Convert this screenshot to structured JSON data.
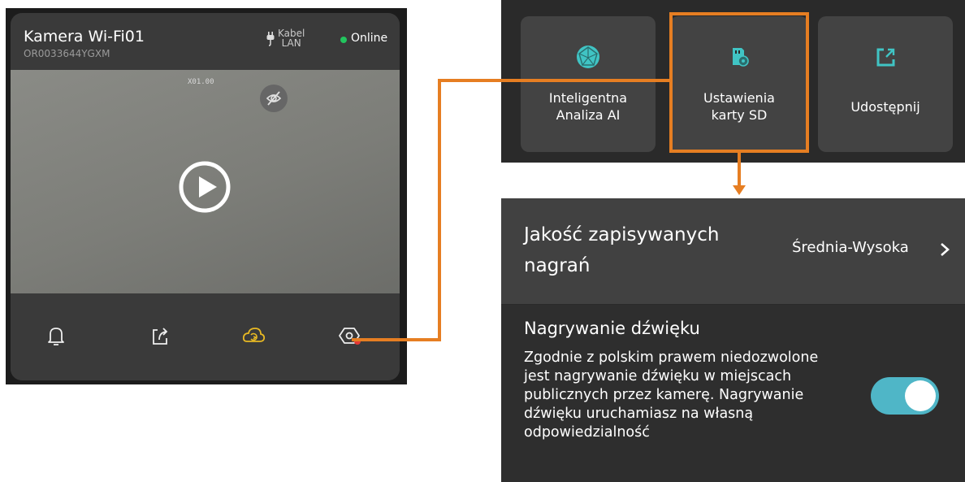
{
  "camera": {
    "title": "Kamera Wi-Fi01",
    "serial": "OR0033644YGXM",
    "connection_line1": "Kabel",
    "connection_line2": "LAN",
    "status": "Online",
    "zoom": "X01.00",
    "toolbar": {
      "alarm_icon": "bell-icon",
      "share_icon": "share-icon",
      "cloud_icon": "cloud-replay-icon",
      "settings_icon": "settings-icon"
    }
  },
  "tiles": [
    {
      "label_line1": "Inteligentna",
      "label_line2": "Analiza AI",
      "icon": "ai-analysis-icon"
    },
    {
      "label_line1": "Ustawienia",
      "label_line2": "karty SD",
      "icon": "sd-card-settings-icon"
    },
    {
      "label_line1": "Udostępnij",
      "label_line2": "",
      "icon": "share-icon"
    }
  ],
  "settings": {
    "quality_label": "Jakość zapisywanych nagrań",
    "quality_value": "Średnia-Wysoka",
    "audio_title": "Nagrywanie dźwięku",
    "audio_description": "Zgodnie z polskim prawem niedozwolone jest nagrywanie dźwięku w miejscach publicznych przez kamerę. Nagrywanie dźwięku uruchamiasz na własną odpowiedzialność",
    "audio_enabled": true
  },
  "colors": {
    "highlight": "#e67e22",
    "online": "#22c55e",
    "accent": "#e8b923",
    "toggle_on": "#4fb6c7",
    "teal_icon": "#40c4c4"
  }
}
